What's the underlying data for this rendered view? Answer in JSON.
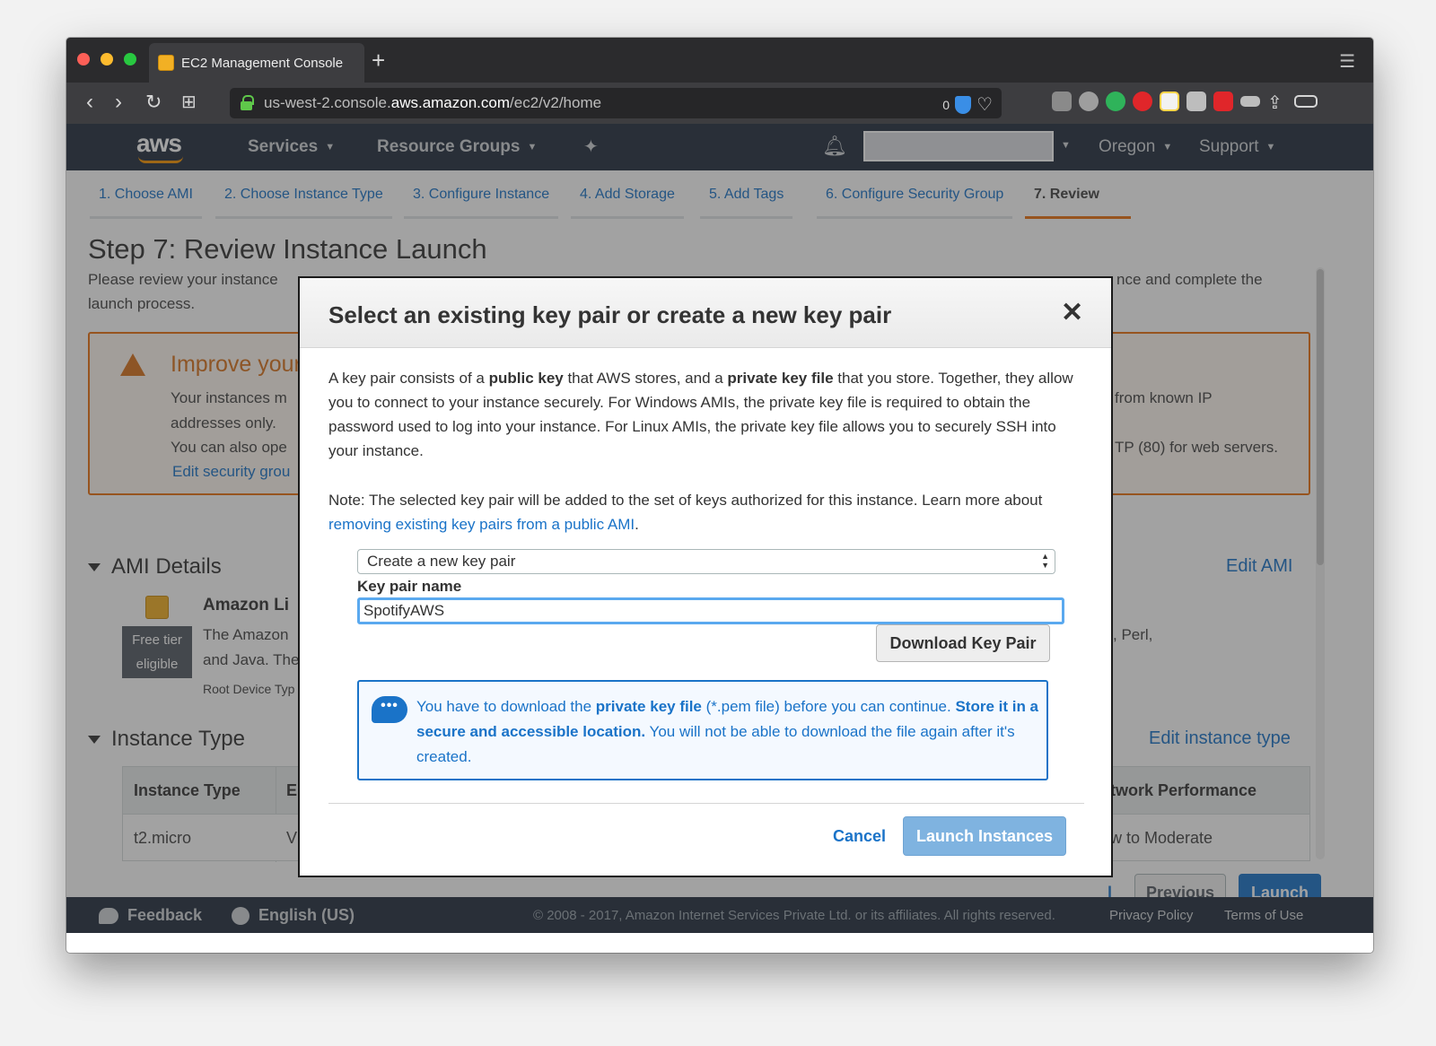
{
  "browser": {
    "tab_title": "EC2 Management Console",
    "new_tab": "+",
    "url_prefix": "us-west-2.console.",
    "url_host": "aws.amazon.com",
    "url_path": "/ec2/v2/home",
    "blocked_count": "0"
  },
  "aws_nav": {
    "logo": "aws",
    "services": "Services",
    "resource_groups": "Resource Groups",
    "region": "Oregon",
    "support": "Support"
  },
  "wizard": {
    "steps": [
      "1. Choose AMI",
      "2. Choose Instance Type",
      "3. Configure Instance",
      "4. Add Storage",
      "5. Add Tags",
      "6. Configure Security Group",
      "7. Review"
    ],
    "active_step": "7. Review",
    "title": "Step 7: Review Instance Launch",
    "description_start": "Please review your instance ",
    "description_end": "nce and complete the",
    "description_line2": "launch process."
  },
  "warning": {
    "title": "Improve your",
    "line1": "Your instances m",
    "line2": "addresses only.",
    "line3": "You can also ope",
    "link": "Edit security grou",
    "right1": "from known IP",
    "right2": "TP (80) for web servers."
  },
  "ami": {
    "section": "AMI Details",
    "edit_link": "Edit AMI",
    "name": "Amazon Li",
    "free_tier_line1": "Free tier",
    "free_tier_line2": "eligible",
    "desc1": "The Amazon",
    "desc2": "and Java. The",
    "desc_right": ", Perl,",
    "root": "Root Device Typ"
  },
  "instance_type": {
    "section": "Instance Type",
    "edit_link": "Edit instance type",
    "header_col1": "Instance Type",
    "header_col2": "E",
    "header_right": "twork Performance",
    "row_col1": "t2.micro",
    "row_col2": "V",
    "row_right": "w to Moderate"
  },
  "actions": {
    "cancel_partial": "l",
    "previous": "Previous",
    "launch": "Launch"
  },
  "footer": {
    "feedback": "Feedback",
    "language": "English (US)",
    "copyright": "© 2008 - 2017, Amazon Internet Services Private Ltd. or its affiliates. All rights reserved.",
    "privacy": "Privacy Policy",
    "terms": "Terms of Use"
  },
  "modal": {
    "title": "Select an existing key pair or create a new key pair",
    "p1_a": "A key pair consists of a ",
    "p1_b": "public key",
    "p1_c": " that AWS stores, and a ",
    "p1_d": "private key file",
    "p1_e": " that you store. Together, they allow you to connect to your instance securely. For Windows AMIs, the private key file is required to obtain the password used to log into your instance. For Linux AMIs, the private key file allows you to securely SSH into your instance.",
    "note_a": "Note: The selected key pair will be added to the set of keys authorized for this instance. Learn more about ",
    "note_link": "removing existing key pairs from a public AMI",
    "note_end": ".",
    "select_value": "Create a new key pair",
    "key_pair_label": "Key pair name",
    "key_pair_value": "SpotifyAWS",
    "download_button": "Download Key Pair",
    "info_a": "You have to download the ",
    "info_b": "private key file",
    "info_c": " (*.pem file) before you can continue. ",
    "info_d": "Store it in a secure and accessible location.",
    "info_e": " You will not be able to download the file again after it's created.",
    "cancel_button": "Cancel",
    "launch_button": "Launch Instances"
  }
}
